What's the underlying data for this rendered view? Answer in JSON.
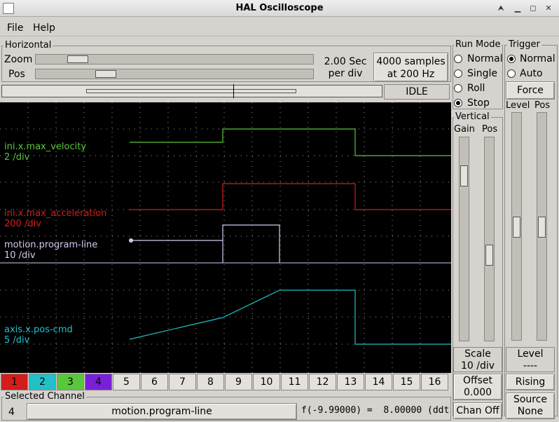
{
  "window": {
    "title": "HAL Oscilloscope"
  },
  "menu": {
    "file": "File",
    "help": "Help"
  },
  "horizontal": {
    "group_label": "Horizontal",
    "zoom_label": "Zoom",
    "pos_label": "Pos",
    "zoom_level": 0.12,
    "pos_level": 0.23,
    "rate_line1": "2.00 Sec",
    "rate_line2": "per div",
    "samples_line1": "4000 samples",
    "samples_line2": "at 200 Hz",
    "status": "IDLE"
  },
  "run_mode": {
    "label": "Run Mode",
    "options": [
      "Normal",
      "Single",
      "Roll",
      "Stop"
    ],
    "selected": "Stop"
  },
  "trigger": {
    "label": "Trigger",
    "options": [
      "Normal",
      "Auto"
    ],
    "selected": "Normal",
    "force_label": "Force",
    "level_label": "Level",
    "pos_label": "Pos",
    "level_caption": "Level",
    "level_value": "----",
    "edge_button": "Rising",
    "source_line1": "Source",
    "source_line2": "None"
  },
  "vertical": {
    "label": "Vertical",
    "gain_label": "Gain",
    "pos_label": "Pos",
    "scale_label": "Scale",
    "scale_value": "10 /div",
    "offset_label": "Offset",
    "offset_value": "0.000",
    "chan_off": "Chan Off"
  },
  "channels": {
    "traces": [
      {
        "name": "ini.x.max_velocity",
        "scale": "2 /div",
        "color": "#58c83a"
      },
      {
        "name": "ini.x.max_acceleration",
        "scale": "200 /div",
        "color": "#d41c1c"
      },
      {
        "name": "motion.program-line",
        "scale": "10 /div",
        "color": "#d8c8f0"
      },
      {
        "name": "axis.x.pos-cmd",
        "scale": "5 /div",
        "color": "#22c0c8"
      }
    ],
    "buttons": [
      "1",
      "2",
      "3",
      "4",
      "5",
      "6",
      "7",
      "8",
      "9",
      "10",
      "11",
      "12",
      "13",
      "14",
      "15",
      "16"
    ],
    "button_colors": [
      "#d41c1c",
      "#22c0c8",
      "#58c83a",
      "#7a1fd8"
    ]
  },
  "selected_channel": {
    "label": "Selected Channel",
    "number": "4",
    "name": "motion.program-line",
    "readout": "f(-9.99000) =  8.00000 (ddt"
  }
}
